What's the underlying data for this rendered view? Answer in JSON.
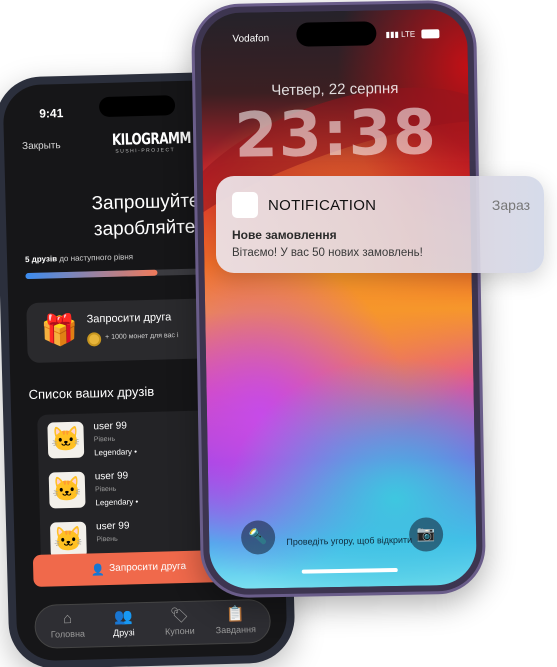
{
  "back_phone": {
    "status_time": "9:41",
    "close_label": "Закрыть",
    "logo_main": "KILOGRAMM",
    "logo_sub": "SUSHI-PROJECT",
    "title_line1": "Запрошуйте дру",
    "title_line2": "заробляйте мон",
    "progress": {
      "count_label": "5 друзів",
      "suffix_label": "до наступного рівня",
      "fraction": 0.55
    },
    "invite_card": {
      "title": "Запросити друга",
      "subtitle": "+ 1000 монет для вас і"
    },
    "friends_title": "Список ваших друзів",
    "friends": [
      {
        "name": "user 99",
        "level_label": "Рівень",
        "status": "Legendary •"
      },
      {
        "name": "user 99",
        "level_label": "Рівень",
        "status": "Legendary •"
      },
      {
        "name": "user 99",
        "level_label": "Рівень",
        "status": ""
      }
    ],
    "cta_label": "Запросити друга",
    "tabs": [
      {
        "label": "Головна",
        "icon": "home-icon",
        "active": false
      },
      {
        "label": "Друзі",
        "icon": "friends-icon",
        "active": true
      },
      {
        "label": "Купони",
        "icon": "coupon-icon",
        "active": false
      },
      {
        "label": "Завдання",
        "icon": "tasks-icon",
        "active": false
      }
    ]
  },
  "front_phone": {
    "carrier": "Vodafon",
    "network": "LTE",
    "date": "Четвер, 22 серпня",
    "time": "23:38",
    "swipe_hint": "Проведіть угору, щоб відкрити"
  },
  "notification": {
    "app_name": "NOTIFICATION",
    "time": "Зараз",
    "title": "Нове замовлення",
    "body": "Вітаємо! У вас 50 нових замовлень!"
  },
  "colors": {
    "accent": "#f0694b",
    "progress_start": "#3b8cf0",
    "progress_end": "#f07a5a",
    "coin": "#e7b53a"
  }
}
